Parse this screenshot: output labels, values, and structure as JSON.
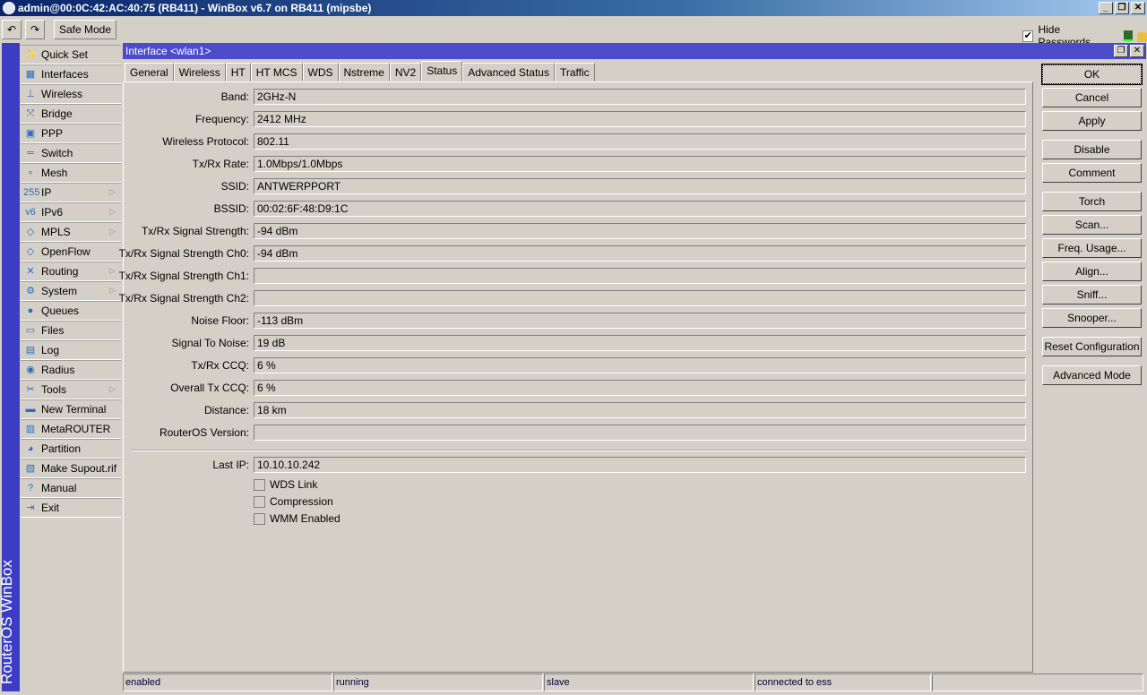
{
  "app": {
    "title": "admin@00:0C:42:AC:40:75 (RB411) - WinBox v6.7 on RB411 (mipsbe)",
    "vertical_label": "RouterOS WinBox"
  },
  "toolbar": {
    "undo": "↶",
    "redo": "↷",
    "safe_mode": "Safe Mode",
    "hide_passwords": "Hide Passwords",
    "hide_passwords_checked": true
  },
  "menu": [
    {
      "label": "Quick Set",
      "icon": "✨"
    },
    {
      "label": "Interfaces",
      "icon": "▦"
    },
    {
      "label": "Wireless",
      "icon": "⊥"
    },
    {
      "label": "Bridge",
      "icon": "⤧"
    },
    {
      "label": "PPP",
      "icon": "▣"
    },
    {
      "label": "Switch",
      "icon": "═"
    },
    {
      "label": "Mesh",
      "icon": "∘"
    },
    {
      "label": "IP",
      "icon": "255",
      "sub": true
    },
    {
      "label": "IPv6",
      "icon": "v6",
      "sub": true
    },
    {
      "label": "MPLS",
      "icon": "◇",
      "sub": true
    },
    {
      "label": "OpenFlow",
      "icon": "◇"
    },
    {
      "label": "Routing",
      "icon": "✕",
      "sub": true
    },
    {
      "label": "System",
      "icon": "⚙",
      "sub": true
    },
    {
      "label": "Queues",
      "icon": "●"
    },
    {
      "label": "Files",
      "icon": "▭"
    },
    {
      "label": "Log",
      "icon": "▤"
    },
    {
      "label": "Radius",
      "icon": "◉"
    },
    {
      "label": "Tools",
      "icon": "✂",
      "sub": true
    },
    {
      "label": "New Terminal",
      "icon": "▬"
    },
    {
      "label": "MetaROUTER",
      "icon": "▥"
    },
    {
      "label": "Partition",
      "icon": "◕"
    },
    {
      "label": "Make Supout.rif",
      "icon": "▧"
    },
    {
      "label": "Manual",
      "icon": "?"
    },
    {
      "label": "Exit",
      "icon": "⇥"
    }
  ],
  "window": {
    "title": "Interface <wlan1>",
    "tabs": [
      "General",
      "Wireless",
      "HT",
      "HT MCS",
      "WDS",
      "Nstreme",
      "NV2",
      "Status",
      "Advanced Status",
      "Traffic"
    ],
    "active_tab": "Status",
    "fields": [
      {
        "label": "Band:",
        "value": "2GHz-N"
      },
      {
        "label": "Frequency:",
        "value": "2412 MHz"
      },
      {
        "label": "Wireless Protocol:",
        "value": "802.11"
      },
      {
        "label": "Tx/Rx Rate:",
        "value": "1.0Mbps/1.0Mbps"
      },
      {
        "label": "SSID:",
        "value": "ANTWERPPORT"
      },
      {
        "label": "BSSID:",
        "value": "00:02:6F:48:D9:1C"
      },
      {
        "label": "Tx/Rx Signal Strength:",
        "value": "-94 dBm"
      },
      {
        "label": "Tx/Rx Signal Strength Ch0:",
        "value": "-94 dBm"
      },
      {
        "label": "Tx/Rx Signal Strength Ch1:",
        "value": ""
      },
      {
        "label": "Tx/Rx Signal Strength Ch2:",
        "value": ""
      },
      {
        "label": "Noise Floor:",
        "value": "-113 dBm"
      },
      {
        "label": "Signal To Noise:",
        "value": "19 dB"
      },
      {
        "label": "Tx/Rx CCQ:",
        "value": "6 %"
      },
      {
        "label": "Overall Tx CCQ:",
        "value": "6 %"
      },
      {
        "label": "Distance:",
        "value": "18 km"
      },
      {
        "label": "RouterOS Version:",
        "value": ""
      }
    ],
    "last_ip": {
      "label": "Last IP:",
      "value": "10.10.10.242"
    },
    "checkboxes": [
      {
        "label": "WDS Link",
        "checked": false
      },
      {
        "label": "Compression",
        "checked": false
      },
      {
        "label": "WMM Enabled",
        "checked": false
      }
    ],
    "buttons": [
      "OK",
      "Cancel",
      "Apply",
      "Disable",
      "Comment",
      "Torch",
      "Scan...",
      "Freq. Usage...",
      "Align...",
      "Sniff...",
      "Snooper...",
      "Reset Configuration",
      "Advanced Mode"
    ],
    "status": [
      "enabled",
      "running",
      "slave",
      "connected to ess",
      ""
    ]
  }
}
